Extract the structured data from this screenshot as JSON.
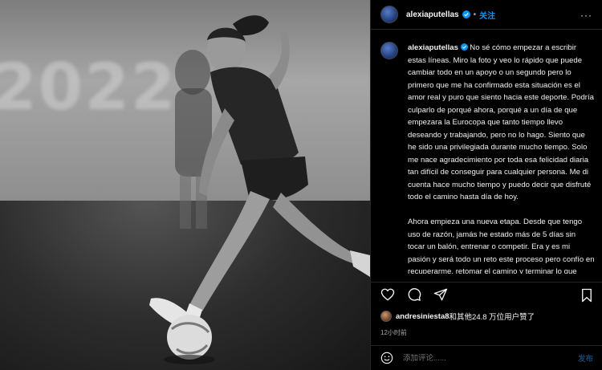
{
  "photo": {
    "background_text": "2022"
  },
  "header": {
    "username": "alexiaputellas",
    "separator": "•",
    "follow_label": "关注",
    "more_label": "···"
  },
  "caption": {
    "username": "alexiaputellas",
    "text": "No sé cómo empezar a escribir estas líneas. Miro la foto y veo lo rápido que puede cambiar todo en un apoyo o un segundo pero lo primero que me ha confirmado esta situación es el amor real y puro que siento hacia este deporte. Podría culparlo de porqué ahora, porqué a un día de que empezara la Eurocopa que tanto tiempo llevo deseando y trabajando, pero no lo hago. Siento que he sido una privilegiada durante mucho tiempo. Solo me nace agradecimiento por toda esa felicidad diaria tan difícil de conseguir para cualquier persona. Me di cuenta hace mucho tiempo y puedo decir que disfruté todo el camino hasta día de hoy.\n\nAhora empieza una nueva etapa. Desde que tengo uso de razón, jamás he estado más de 5 días sin tocar un balón, entrenar o competir. Era y es mi pasión y será todo un reto este proceso pero confío en recuperarme, retomar el camino y terminar lo que empecé."
  },
  "likes": {
    "liker": "andresiniesta8",
    "rest": "和其他24.8 万位用户赞了"
  },
  "timestamp": "12小时前",
  "comment": {
    "placeholder": "添加评论......",
    "post_label": "发布"
  },
  "colors": {
    "accent": "#0095f6",
    "post_disabled": "#16466e",
    "muted": "#a8a8a8"
  },
  "icons": [
    "verified-badge-icon",
    "heart-icon",
    "comment-icon",
    "share-icon",
    "bookmark-icon",
    "emoji-icon",
    "more-icon"
  ]
}
